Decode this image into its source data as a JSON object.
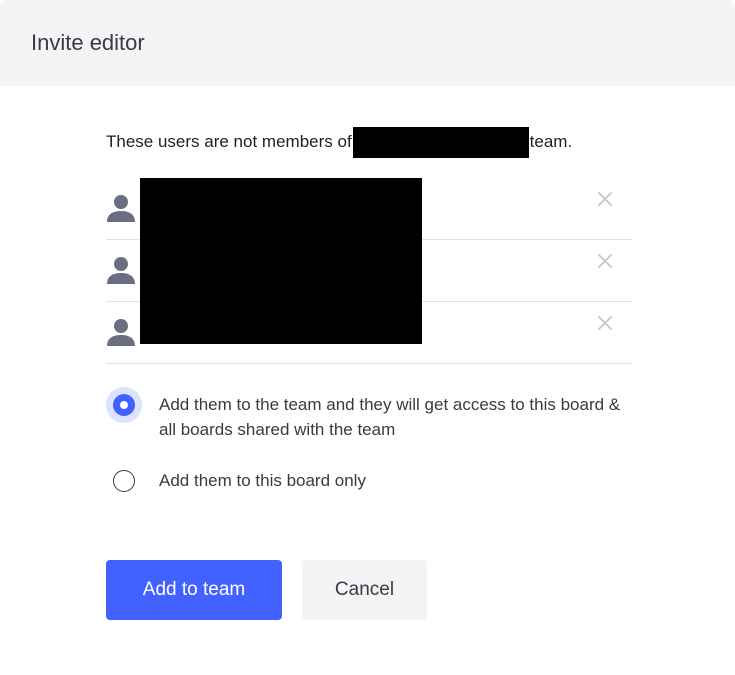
{
  "dialog": {
    "title": "Invite editor"
  },
  "notice": {
    "prefix": "These users are not members of",
    "suffix": "team."
  },
  "users": [
    {
      "avatar_icon": "user-icon",
      "remove_icon": "close-icon"
    },
    {
      "avatar_icon": "user-icon",
      "remove_icon": "close-icon"
    },
    {
      "avatar_icon": "user-icon",
      "remove_icon": "close-icon"
    }
  ],
  "options": [
    {
      "label": "Add them to the team and they will get access to this board & all boards shared with the team",
      "selected": true
    },
    {
      "label": "Add them to this board only",
      "selected": false
    }
  ],
  "buttons": {
    "primary": "Add to team",
    "secondary": "Cancel"
  },
  "colors": {
    "accent": "#4262ff",
    "header_bg": "#f3f4f6",
    "avatar": "#6b6e80",
    "divider": "#e1e2e6"
  }
}
